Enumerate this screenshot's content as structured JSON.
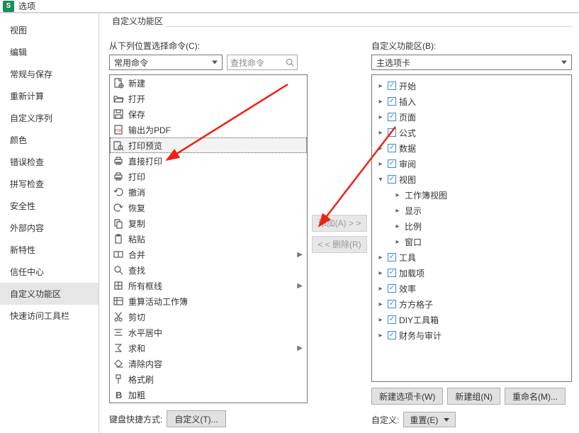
{
  "title": "选项",
  "app_letter": "S",
  "sidebar": {
    "items": [
      "视图",
      "编辑",
      "常规与保存",
      "重新计算",
      "自定义序列",
      "颜色",
      "错误检查",
      "拼写检查",
      "安全性",
      "外部内容",
      "新特性",
      "信任中心",
      "自定义功能区",
      "快速访问工具栏"
    ],
    "selected_index": 12
  },
  "fieldset_label": "自定义功能区",
  "left": {
    "label": "从下列位置选择命令(C):",
    "select_value": "常用命令",
    "search_placeholder": "查找命令",
    "commands": [
      {
        "icon": "new",
        "label": "新建"
      },
      {
        "icon": "open",
        "label": "打开"
      },
      {
        "icon": "save",
        "label": "保存"
      },
      {
        "icon": "pdf",
        "label": "输出为PDF"
      },
      {
        "icon": "preview",
        "label": "打印预览",
        "selected": true
      },
      {
        "icon": "directprint",
        "label": "直接打印"
      },
      {
        "icon": "print",
        "label": "打印"
      },
      {
        "icon": "undo",
        "label": "撤消"
      },
      {
        "icon": "redo",
        "label": "恢复"
      },
      {
        "icon": "copy",
        "label": "复制"
      },
      {
        "icon": "paste",
        "label": "粘贴"
      },
      {
        "icon": "merge",
        "label": "合并",
        "sub": true
      },
      {
        "icon": "find",
        "label": "查找"
      },
      {
        "icon": "borders",
        "label": "所有框线",
        "sub": true
      },
      {
        "icon": "recalc",
        "label": "重算活动工作簿"
      },
      {
        "icon": "cut",
        "label": "剪切"
      },
      {
        "icon": "center",
        "label": "水平居中"
      },
      {
        "icon": "sum",
        "label": "求和",
        "sub": true
      },
      {
        "icon": "clear",
        "label": "清除内容"
      },
      {
        "icon": "format",
        "label": "格式刷"
      },
      {
        "icon": "bold",
        "label": "加粗"
      }
    ]
  },
  "mid": {
    "add_label": "添加(A) > >",
    "remove_label": "< < 删除(R)"
  },
  "right": {
    "label": "自定义功能区(B):",
    "select_value": "主选项卡",
    "tree": [
      {
        "label": "开始",
        "checked": true,
        "expanded": false
      },
      {
        "label": "插入",
        "checked": true,
        "expanded": false
      },
      {
        "label": "页面",
        "checked": true,
        "expanded": false
      },
      {
        "label": "公式",
        "checked": true,
        "expanded": false
      },
      {
        "label": "数据",
        "checked": true,
        "expanded": false
      },
      {
        "label": "审阅",
        "checked": true,
        "expanded": false
      },
      {
        "label": "视图",
        "checked": true,
        "expanded": true,
        "children": [
          {
            "label": "工作簿视图"
          },
          {
            "label": "显示"
          },
          {
            "label": "比例"
          },
          {
            "label": "窗口"
          }
        ]
      },
      {
        "label": "工具",
        "checked": true,
        "expanded": false
      },
      {
        "label": "加载项",
        "checked": true,
        "expanded": false
      },
      {
        "label": "效率",
        "checked": true,
        "expanded": false
      },
      {
        "label": "方方格子",
        "checked": true,
        "expanded": false
      },
      {
        "label": "DIY工具箱",
        "checked": true,
        "expanded": false
      },
      {
        "label": "财务与审计",
        "checked": true,
        "expanded": false
      }
    ],
    "buttons": {
      "new_tab": "新建选项卡(W)",
      "new_group": "新建组(N)",
      "rename": "重命名(M)..."
    },
    "custom_label": "自定义:",
    "reset_label": "重置(E)"
  },
  "footer": {
    "kbd_label": "键盘快捷方式:",
    "customize_label": "自定义(T)..."
  }
}
